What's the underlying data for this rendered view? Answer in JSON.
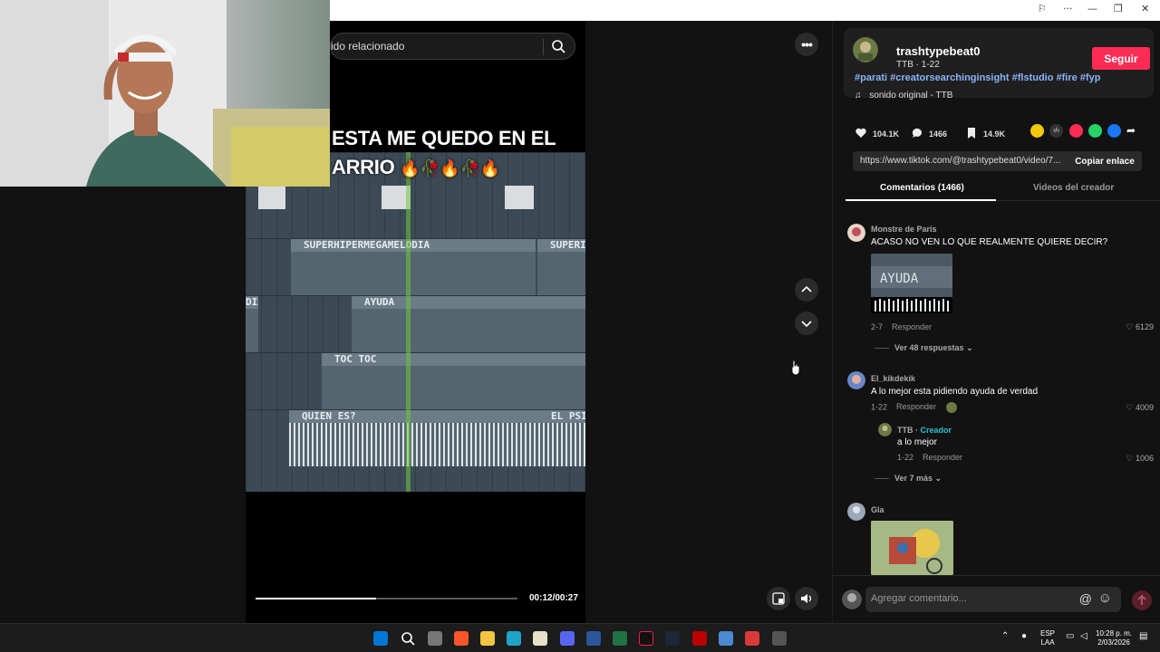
{
  "video": {
    "search_placeholder": "ido relacionado",
    "overlay_line1": "ESTA ME QUEDO EN EL",
    "overlay_line2": "ARRIO",
    "overlay_emojis": "🔥🥀🔥🥀🔥",
    "tracks": [
      "SUPERHIPERMEGAMELODIA",
      "SUPERI",
      "DIA",
      "AYUDA",
      "TOC TOC",
      "QUIEN ES?",
      "EL PSIC"
    ],
    "time": "00:12/00:27",
    "progress": 0.46
  },
  "creator": {
    "username": "trashtypebeat0",
    "subtitle": "TTB · 1-22",
    "follow_label": "Seguir",
    "hashtags": "#parati #creatorsearchinginsight #flstudio #fire #fyp",
    "sound": "sonido original - TTB"
  },
  "stats": {
    "likes": "104.1K",
    "comments": "1466",
    "saves": "14.9K"
  },
  "share": {
    "url": "https://www.tiktok.com/@trashtypebeat0/video/7...",
    "copy_label": "Copiar enlace"
  },
  "tabs": {
    "comments": "Comentarios (1466)",
    "creator_videos": "Videos del creador"
  },
  "comments": [
    {
      "author": "Monstre de Paris",
      "text": "ACASO NO VEN LO QUE REALMENTE QUIERE DECIR?",
      "date": "2-7",
      "reply": "Responder",
      "likes": "6129",
      "more": "Ver 48 respuestas"
    },
    {
      "author": "El_kikdekik",
      "text": "A lo mejor esta pidiendo ayuda de verdad",
      "date": "1-22",
      "reply": "Responder",
      "likes": "4009",
      "more": "Ver 7 más"
    },
    {
      "author": "Gla",
      "text": "",
      "date": "",
      "reply": "",
      "likes": "",
      "more": ""
    }
  ],
  "creator_reply": {
    "author": "TTB",
    "tag": "Creador",
    "text": "a lo mejor",
    "date": "1-22",
    "reply": "Responder",
    "likes": "1006"
  },
  "comment_box": {
    "placeholder": "Agregar comentario..."
  },
  "taskbar": {
    "lang1": "ESP",
    "lang2": "LAA",
    "time": "10:28 p. m.",
    "date": "2/03/2026"
  },
  "colors": {
    "follow": "#fe2c55",
    "hashtag": "#8ab4f8",
    "creator_tag": "#25c1d9"
  }
}
